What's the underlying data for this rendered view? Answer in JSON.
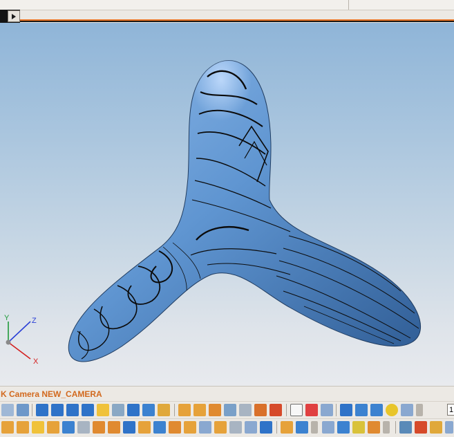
{
  "status": {
    "camera_text": "K Camera NEW_CAMERA"
  },
  "triad": {
    "x_label": "X",
    "y_label": "Y",
    "z_label": "Z"
  },
  "toolbar_top": {
    "combo_value": "1"
  },
  "colors": {
    "accent": "#e8701e",
    "status_text": "#d2691e",
    "model_surface": "#5f95d1",
    "contour": "#0b0b0b"
  },
  "icons": {
    "expander": "chevron-right-icon"
  }
}
